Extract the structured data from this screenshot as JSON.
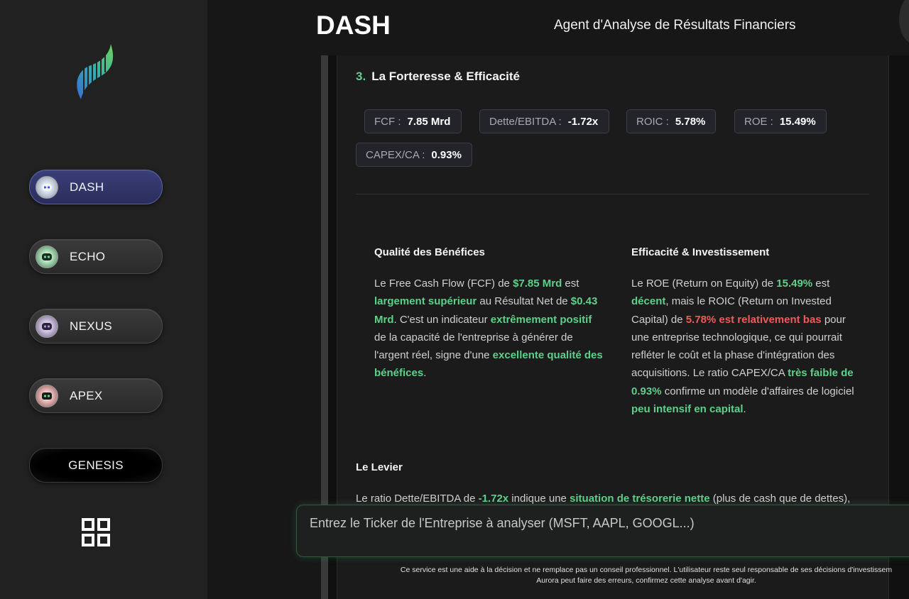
{
  "sidebar": {
    "agents": [
      {
        "label": "DASH",
        "icon": "robot-avatar-icon",
        "active": true
      },
      {
        "label": "ECHO",
        "icon": "robot-avatar-icon"
      },
      {
        "label": "NEXUS",
        "icon": "robot-avatar-icon"
      },
      {
        "label": "APEX",
        "icon": "robot-avatar-icon"
      },
      {
        "label": "GENESIS"
      }
    ],
    "apps_icon": "grid-icon"
  },
  "header": {
    "brand": "DASH",
    "subtitle": "Agent d'Analyse de Résultats Financiers"
  },
  "section": {
    "number": "3.",
    "title": "La Forteresse & Efficacité"
  },
  "metrics": [
    {
      "key": "FCF :",
      "value": "7.85 Mrd"
    },
    {
      "key": "Dette/EBITDA :",
      "value": "-1.72x"
    },
    {
      "key": "ROIC :",
      "value": "5.78%"
    },
    {
      "key": "ROE :",
      "value": "15.49%"
    },
    {
      "key": "CAPEX/CA :",
      "value": "0.93%"
    }
  ],
  "quality": {
    "title": "Qualité des Bénéfices",
    "t1": "Le Free Cash Flow (FCF) de ",
    "h1": "$7.85 Mrd",
    "t2": " est ",
    "h2": "largement supérieur",
    "t3": " au Résultat Net de ",
    "h3": "$0.43 Mrd",
    "t4": ". C'est un indicateur ",
    "h4": "extrêmement positif",
    "t5": " de la capacité de l'entreprise à générer de l'argent réel, signe d'une ",
    "h5": "excellente qualité des bénéfices",
    "t6": "."
  },
  "efficiency": {
    "title": "Efficacité & Investissement",
    "t1": "Le ROE (Return on Equity) de ",
    "h1": "15.49%",
    "t2": " est ",
    "h2": "décent",
    "t3": ", mais le ROIC (Return on Invested Capital) de ",
    "r1": "5.78% est relativement bas",
    "t4": " pour une entreprise technologique, ce qui pourrait refléter le coût et la phase d'intégration des acquisitions. Le ratio CAPEX/CA ",
    "h3": "très faible de 0.93%",
    "t5": " confirme un modèle d'affaires de logiciel ",
    "h4": "peu intensif en capital",
    "t6": "."
  },
  "leverage": {
    "title": "Le Levier",
    "t1": "Le ratio Dette/EBITDA de ",
    "h1": "-1.72x",
    "t2": " indique une ",
    "h2": "situation de trésorerie nette",
    "t3": " (plus de cash que de dettes),"
  },
  "input": {
    "placeholder": "Entrez le Ticker de l'Entreprise à analyser (MSFT, AAPL, GOOGL...)"
  },
  "disclaimer": {
    "line1": "Ce service est une aide à la décision et ne remplace pas un conseil professionnel. L'utilisateur reste seul responsable de ses décisions d'investissem",
    "line2": "Aurora peut faire des erreurs, confirmez cette analyse avant d'agir."
  },
  "colors": {
    "accent_green": "#5fd08a",
    "accent_red": "#f05a5a",
    "active_agent": "#3a3f78"
  }
}
